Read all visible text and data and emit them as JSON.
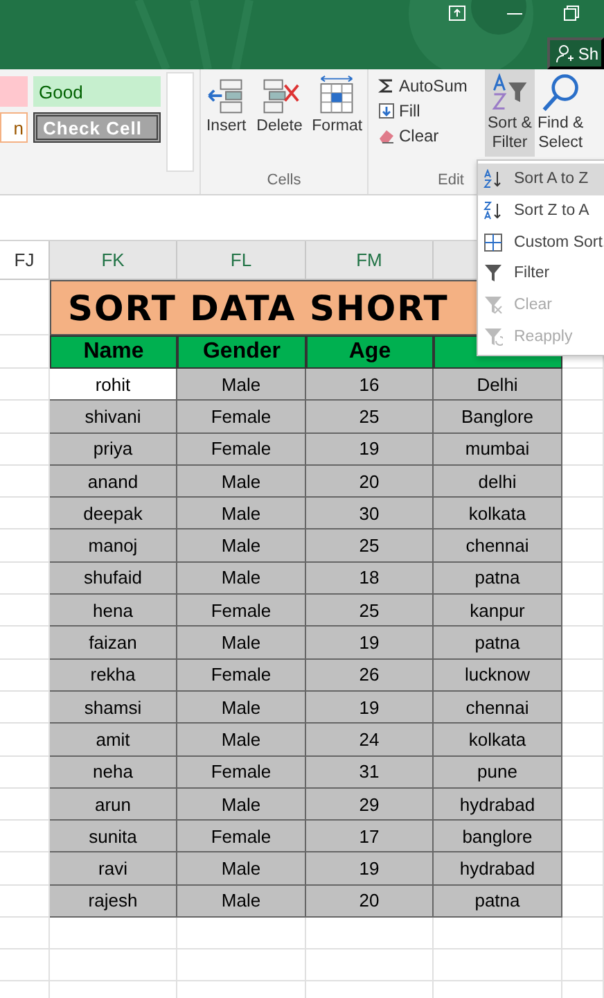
{
  "title_bar": {
    "share": "Sh"
  },
  "styles": [
    {
      "kind": "bad"
    },
    {
      "label": "Good",
      "kind": "good"
    },
    {
      "label": "n",
      "kind": "neutral"
    },
    {
      "label": "Check Cell",
      "kind": "check"
    }
  ],
  "cells_group": {
    "label": "Cells",
    "buttons": [
      {
        "label": "Insert",
        "kind": "insert"
      },
      {
        "label": "Delete",
        "kind": "delete"
      },
      {
        "label": "Format",
        "kind": "format"
      }
    ]
  },
  "editing_group": {
    "label": "Edit",
    "small": [
      {
        "label": "AutoSum",
        "kind": "sum"
      },
      {
        "label": "Fill",
        "kind": "fill"
      },
      {
        "label": "Clear",
        "kind": "clear"
      }
    ],
    "large": [
      {
        "label": "Sort &",
        "label2": "Filter",
        "kind": "sort",
        "selected": true
      },
      {
        "label": "Find &",
        "label2": "Select",
        "kind": "find",
        "selected": false
      }
    ]
  },
  "columns": [
    "FJ",
    "FK",
    "FL",
    "FM"
  ],
  "sheet": {
    "title": "SORT DATA SHORT",
    "headers": [
      "Name",
      "Gender",
      "Age"
    ],
    "rows": [
      {
        "name": "rohit",
        "gender": "Male",
        "age": "16",
        "city": "Delhi",
        "active": true
      },
      {
        "name": "shivani",
        "gender": "Female",
        "age": "25",
        "city": "Banglore",
        "active": false
      },
      {
        "name": "priya",
        "gender": "Female",
        "age": "19",
        "city": "mumbai",
        "active": false
      },
      {
        "name": "anand",
        "gender": "Male",
        "age": "20",
        "city": "delhi",
        "active": false
      },
      {
        "name": "deepak",
        "gender": "Male",
        "age": "30",
        "city": "kolkata",
        "active": false
      },
      {
        "name": "manoj",
        "gender": "Male",
        "age": "25",
        "city": "chennai",
        "active": false
      },
      {
        "name": "shufaid",
        "gender": "Male",
        "age": "18",
        "city": "patna",
        "active": false
      },
      {
        "name": "hena",
        "gender": "Female",
        "age": "25",
        "city": "kanpur",
        "active": false
      },
      {
        "name": "faizan",
        "gender": "Male",
        "age": "19",
        "city": "patna",
        "active": false
      },
      {
        "name": "rekha",
        "gender": "Female",
        "age": "26",
        "city": "lucknow",
        "active": false
      },
      {
        "name": "shamsi",
        "gender": "Male",
        "age": "19",
        "city": "chennai",
        "active": false
      },
      {
        "name": "amit",
        "gender": "Male",
        "age": "24",
        "city": "kolkata",
        "active": false
      },
      {
        "name": "neha",
        "gender": "Female",
        "age": "31",
        "city": "pune",
        "active": false
      },
      {
        "name": "arun",
        "gender": "Male",
        "age": "29",
        "city": "hydrabad",
        "active": false
      },
      {
        "name": "sunita",
        "gender": "Female",
        "age": "17",
        "city": "banglore",
        "active": false
      },
      {
        "name": "ravi",
        "gender": "Male",
        "age": "19",
        "city": "hydrabad",
        "active": false
      },
      {
        "name": "rajesh",
        "gender": "Male",
        "age": "20",
        "city": "patna",
        "active": false
      }
    ]
  },
  "sort_menu": [
    {
      "label": "Sort A to Z",
      "kind": "az",
      "selected": true,
      "disabled": false
    },
    {
      "label": "Sort Z to A",
      "kind": "za",
      "selected": false,
      "disabled": false
    },
    {
      "label": "Custom Sort.",
      "kind": "custom",
      "selected": false,
      "disabled": false
    },
    {
      "label": "Filter",
      "kind": "filter",
      "selected": false,
      "disabled": false
    },
    {
      "label": "Clear",
      "kind": "clear",
      "selected": false,
      "disabled": true
    },
    {
      "label": "Reapply",
      "kind": "reapply",
      "selected": false,
      "disabled": true
    }
  ]
}
